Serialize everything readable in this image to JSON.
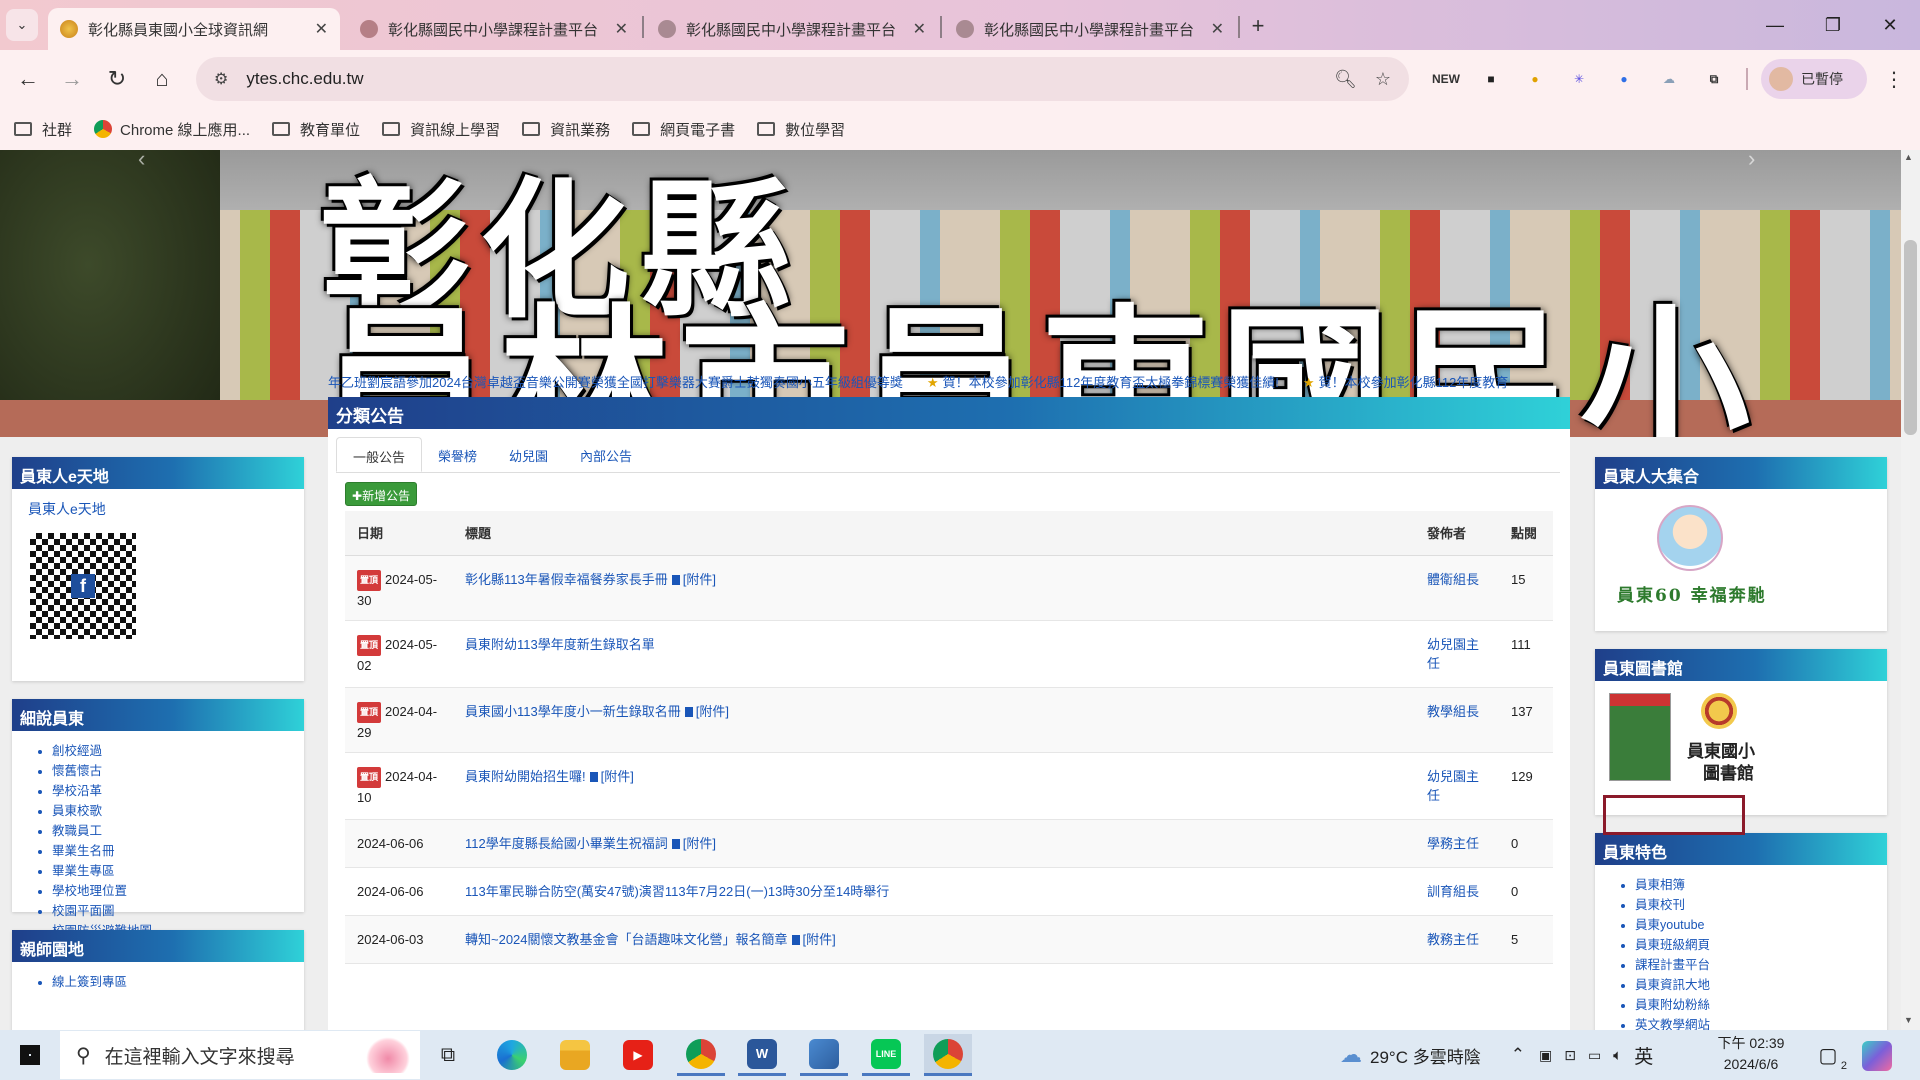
{
  "browser": {
    "tabs": [
      {
        "label": "彰化縣員東國小全球資訊網",
        "active": true
      },
      {
        "label": "彰化縣國民中小學課程計畫平台",
        "active": false
      },
      {
        "label": "彰化縣國民中小學課程計畫平台",
        "active": false
      },
      {
        "label": "彰化縣國民中小學課程計畫平台",
        "active": false
      }
    ],
    "url": "ytes.chc.edu.tw",
    "profile_label": "已暫停",
    "bookmarks": [
      "社群",
      "Chrome 線上應用...",
      "教育單位",
      "資訊線上學習",
      "資訊業務",
      "網頁電子書",
      "數位學習"
    ],
    "extensions": [
      {
        "name": "new-icon",
        "text": "NEW",
        "color": "#333333"
      },
      {
        "name": "square-ext-icon",
        "text": "■",
        "color": "#222222"
      },
      {
        "name": "seal-ext-icon",
        "text": "●",
        "color": "#e0a100"
      },
      {
        "name": "star-ext-icon",
        "text": "✳",
        "color": "#5a4de0"
      },
      {
        "name": "circle-ext-icon",
        "text": "●",
        "color": "#2f6fe6"
      },
      {
        "name": "cloud-ext-icon",
        "text": "☁",
        "color": "#8aa0b8"
      },
      {
        "name": "puzzle-icon",
        "text": "⧉",
        "color": "#333333"
      }
    ]
  },
  "banner": {
    "line1": "彰化縣",
    "line2": "員林市員東國民小學"
  },
  "ticker": [
    "年乙班劉宸語參加2024台灣卓越盃音樂公開賽榮獲全國打擊樂器大賽爵士鼓獨奏國小五年級組優等獎",
    "賀！本校參加彰化縣112年度教育盃太極拳錦標賽榮獲佳績!",
    "賀！本校參加彰化縣112年度教育"
  ],
  "left": {
    "box1": {
      "title": "員東人e天地",
      "link": "員東人e天地"
    },
    "box2": {
      "title": "細說員東",
      "items": [
        "創校經過",
        "懷舊懷古",
        "學校沿革",
        "員東校歌",
        "教職員工",
        "畢業生名冊",
        "畢業生專區",
        "學校地理位置",
        "校園平面圖",
        "校園防災避難地圖"
      ]
    },
    "box3": {
      "title": "親師園地",
      "items": [
        "線上簽到專區"
      ]
    }
  },
  "main": {
    "title": "分類公告",
    "tabs": [
      "一般公告",
      "榮譽榜",
      "幼兒園",
      "內部公告"
    ],
    "add_label": "新增公告",
    "columns": [
      "日期",
      "標題",
      "發佈者",
      "點閱"
    ],
    "pin_label": "置頂",
    "attach_label": "[附件]",
    "rows": [
      {
        "date": "2024-05-30",
        "title": "彰化縣113年暑假幸福餐券家長手冊",
        "pinned": true,
        "attach": true,
        "author": "體衛組長",
        "views": "15"
      },
      {
        "date": "2024-05-02",
        "title": "員東附幼113學年度新生錄取名單",
        "pinned": true,
        "attach": false,
        "author": "幼兒園主任",
        "views": "111"
      },
      {
        "date": "2024-04-29",
        "title": "員東國小113學年度小一新生錄取名冊",
        "pinned": true,
        "attach": true,
        "author": "教學組長",
        "views": "137"
      },
      {
        "date": "2024-04-10",
        "title": "員東附幼開始招生囉!",
        "pinned": true,
        "attach": true,
        "author": "幼兒園主任",
        "views": "129"
      },
      {
        "date": "2024-06-06",
        "title": "112學年度縣長給國小畢業生祝福詞",
        "pinned": false,
        "attach": true,
        "author": "學務主任",
        "views": "0"
      },
      {
        "date": "2024-06-06",
        "title": "113年軍民聯合防空(萬安47號)演習113年7月22日(一)13時30分至14時舉行",
        "pinned": false,
        "attach": false,
        "author": "訓育組長",
        "views": "0"
      },
      {
        "date": "2024-06-03",
        "title": "轉知~2024關懷文教基金會「台語趣味文化營」報名簡章",
        "pinned": false,
        "attach": true,
        "author": "教務主任",
        "views": "5"
      }
    ]
  },
  "right": {
    "box1": {
      "title": "員東人大集合",
      "caption": "員東60 幸福奔馳"
    },
    "box2": {
      "title": "員東圖書館",
      "caption1": "員東國小",
      "caption2": "圖書館"
    },
    "box3": {
      "title": "員東特色",
      "items": [
        "員東相簿",
        "員東校刊",
        "員東youtube",
        "員東班級網頁",
        "課程計畫平台",
        "員東資訊大地",
        "員東附幼粉絲",
        "英文教學網站"
      ]
    }
  },
  "taskbar": {
    "search_placeholder": "在這裡輸入文字來搜尋",
    "weather": "29°C  多雲時陰",
    "ime": "英",
    "time": "下午 02:39",
    "date": "2024/6/6",
    "notif_count": "2"
  },
  "colors": {
    "accent_head": "#1e6fb0",
    "highlight_box": "#8b1a2a",
    "link": "#1a56b8"
  }
}
